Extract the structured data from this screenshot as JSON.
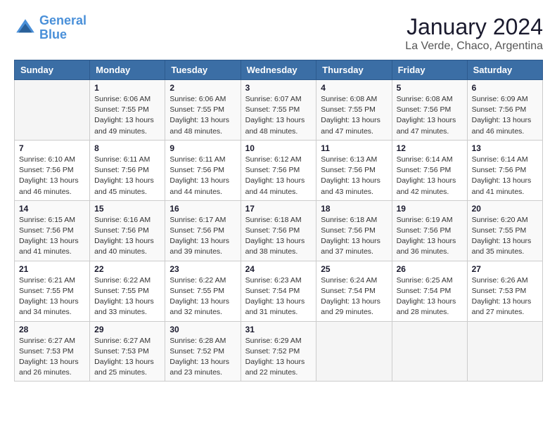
{
  "header": {
    "logo_line1": "General",
    "logo_line2": "Blue",
    "title": "January 2024",
    "subtitle": "La Verde, Chaco, Argentina"
  },
  "days_of_week": [
    "Sunday",
    "Monday",
    "Tuesday",
    "Wednesday",
    "Thursday",
    "Friday",
    "Saturday"
  ],
  "weeks": [
    [
      {
        "day": "",
        "info": ""
      },
      {
        "day": "1",
        "info": "Sunrise: 6:06 AM\nSunset: 7:55 PM\nDaylight: 13 hours\nand 49 minutes."
      },
      {
        "day": "2",
        "info": "Sunrise: 6:06 AM\nSunset: 7:55 PM\nDaylight: 13 hours\nand 48 minutes."
      },
      {
        "day": "3",
        "info": "Sunrise: 6:07 AM\nSunset: 7:55 PM\nDaylight: 13 hours\nand 48 minutes."
      },
      {
        "day": "4",
        "info": "Sunrise: 6:08 AM\nSunset: 7:55 PM\nDaylight: 13 hours\nand 47 minutes."
      },
      {
        "day": "5",
        "info": "Sunrise: 6:08 AM\nSunset: 7:56 PM\nDaylight: 13 hours\nand 47 minutes."
      },
      {
        "day": "6",
        "info": "Sunrise: 6:09 AM\nSunset: 7:56 PM\nDaylight: 13 hours\nand 46 minutes."
      }
    ],
    [
      {
        "day": "7",
        "info": "Sunrise: 6:10 AM\nSunset: 7:56 PM\nDaylight: 13 hours\nand 46 minutes."
      },
      {
        "day": "8",
        "info": "Sunrise: 6:11 AM\nSunset: 7:56 PM\nDaylight: 13 hours\nand 45 minutes."
      },
      {
        "day": "9",
        "info": "Sunrise: 6:11 AM\nSunset: 7:56 PM\nDaylight: 13 hours\nand 44 minutes."
      },
      {
        "day": "10",
        "info": "Sunrise: 6:12 AM\nSunset: 7:56 PM\nDaylight: 13 hours\nand 44 minutes."
      },
      {
        "day": "11",
        "info": "Sunrise: 6:13 AM\nSunset: 7:56 PM\nDaylight: 13 hours\nand 43 minutes."
      },
      {
        "day": "12",
        "info": "Sunrise: 6:14 AM\nSunset: 7:56 PM\nDaylight: 13 hours\nand 42 minutes."
      },
      {
        "day": "13",
        "info": "Sunrise: 6:14 AM\nSunset: 7:56 PM\nDaylight: 13 hours\nand 41 minutes."
      }
    ],
    [
      {
        "day": "14",
        "info": "Sunrise: 6:15 AM\nSunset: 7:56 PM\nDaylight: 13 hours\nand 41 minutes."
      },
      {
        "day": "15",
        "info": "Sunrise: 6:16 AM\nSunset: 7:56 PM\nDaylight: 13 hours\nand 40 minutes."
      },
      {
        "day": "16",
        "info": "Sunrise: 6:17 AM\nSunset: 7:56 PM\nDaylight: 13 hours\nand 39 minutes."
      },
      {
        "day": "17",
        "info": "Sunrise: 6:18 AM\nSunset: 7:56 PM\nDaylight: 13 hours\nand 38 minutes."
      },
      {
        "day": "18",
        "info": "Sunrise: 6:18 AM\nSunset: 7:56 PM\nDaylight: 13 hours\nand 37 minutes."
      },
      {
        "day": "19",
        "info": "Sunrise: 6:19 AM\nSunset: 7:56 PM\nDaylight: 13 hours\nand 36 minutes."
      },
      {
        "day": "20",
        "info": "Sunrise: 6:20 AM\nSunset: 7:55 PM\nDaylight: 13 hours\nand 35 minutes."
      }
    ],
    [
      {
        "day": "21",
        "info": "Sunrise: 6:21 AM\nSunset: 7:55 PM\nDaylight: 13 hours\nand 34 minutes."
      },
      {
        "day": "22",
        "info": "Sunrise: 6:22 AM\nSunset: 7:55 PM\nDaylight: 13 hours\nand 33 minutes."
      },
      {
        "day": "23",
        "info": "Sunrise: 6:22 AM\nSunset: 7:55 PM\nDaylight: 13 hours\nand 32 minutes."
      },
      {
        "day": "24",
        "info": "Sunrise: 6:23 AM\nSunset: 7:54 PM\nDaylight: 13 hours\nand 31 minutes."
      },
      {
        "day": "25",
        "info": "Sunrise: 6:24 AM\nSunset: 7:54 PM\nDaylight: 13 hours\nand 29 minutes."
      },
      {
        "day": "26",
        "info": "Sunrise: 6:25 AM\nSunset: 7:54 PM\nDaylight: 13 hours\nand 28 minutes."
      },
      {
        "day": "27",
        "info": "Sunrise: 6:26 AM\nSunset: 7:53 PM\nDaylight: 13 hours\nand 27 minutes."
      }
    ],
    [
      {
        "day": "28",
        "info": "Sunrise: 6:27 AM\nSunset: 7:53 PM\nDaylight: 13 hours\nand 26 minutes."
      },
      {
        "day": "29",
        "info": "Sunrise: 6:27 AM\nSunset: 7:53 PM\nDaylight: 13 hours\nand 25 minutes."
      },
      {
        "day": "30",
        "info": "Sunrise: 6:28 AM\nSunset: 7:52 PM\nDaylight: 13 hours\nand 23 minutes."
      },
      {
        "day": "31",
        "info": "Sunrise: 6:29 AM\nSunset: 7:52 PM\nDaylight: 13 hours\nand 22 minutes."
      },
      {
        "day": "",
        "info": ""
      },
      {
        "day": "",
        "info": ""
      },
      {
        "day": "",
        "info": ""
      }
    ]
  ]
}
